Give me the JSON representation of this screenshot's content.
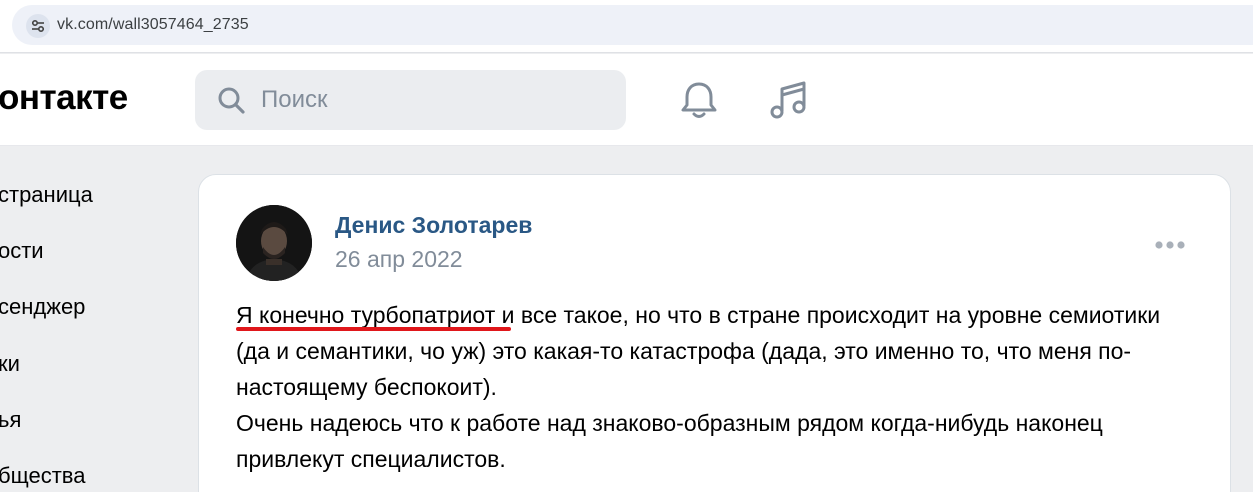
{
  "browser": {
    "url": "vk.com/wall3057464_2735",
    "site_info_icon": "tune-icon"
  },
  "header": {
    "logo_text": "онтакте",
    "search_placeholder": "Поиск",
    "icons": [
      "search-icon",
      "bell-icon",
      "music-icon"
    ]
  },
  "sidebar": {
    "items": [
      {
        "label": "страница"
      },
      {
        "label": "ости"
      },
      {
        "label": "сенджер"
      },
      {
        "label": "ки"
      },
      {
        "label": "ья"
      },
      {
        "label": "бщества"
      }
    ]
  },
  "post": {
    "author": "Денис Золотарев",
    "date": "26 апр 2022",
    "paragraphs": [
      "Я конечно турбопатриот и все такое, но что в стране происходит на уровне семиотики (да и семантики, чо уж) это какая-то катастрофа (дада, это именно то, что меня по-настоящему беспокоит).",
      "Очень надеюсь что к работе над знаково-образным рядом когда-нибудь наконец привлекут специалистов."
    ],
    "more_icon": "more-dots-icon",
    "annotation_color": "#e0171b"
  }
}
